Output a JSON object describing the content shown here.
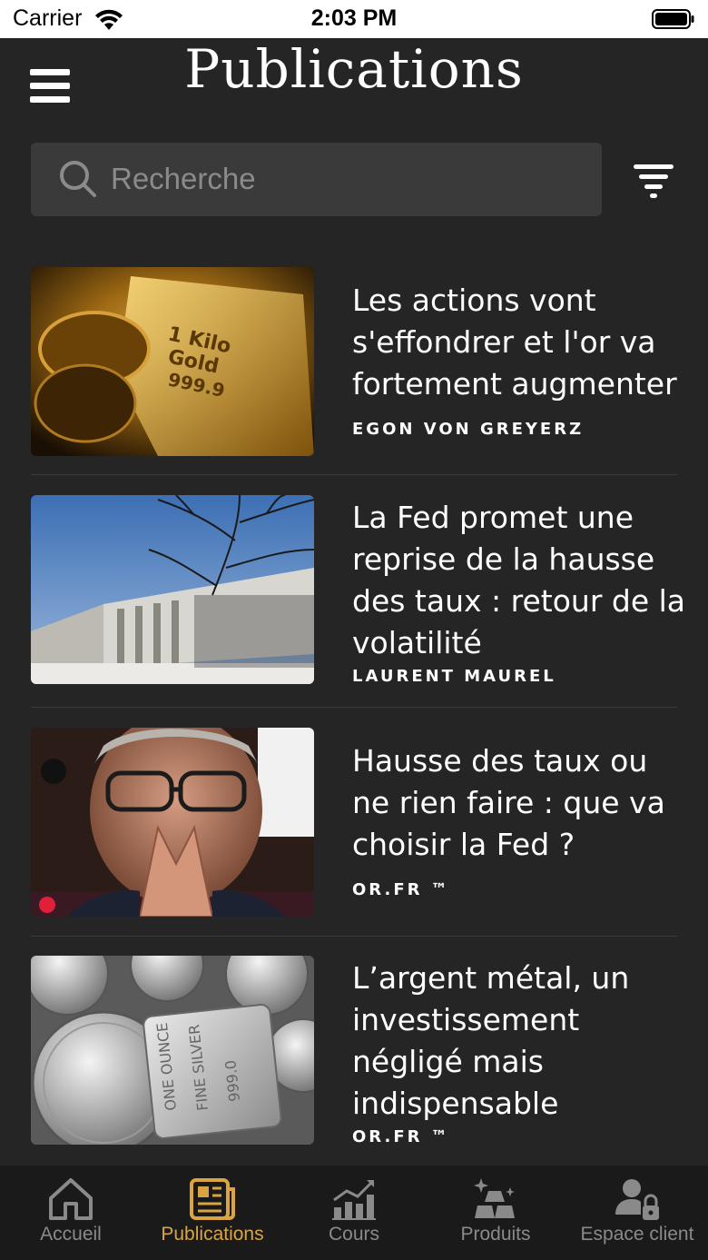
{
  "status_bar": {
    "carrier": "Carrier",
    "time": "2:03 PM"
  },
  "header": {
    "title": "Publications"
  },
  "search": {
    "placeholder": "Recherche"
  },
  "articles": [
    {
      "title": "Les actions vont s'effondrer et l'or va fortement augmenter",
      "author": "EGON VON GREYERZ",
      "image": "gold-bar-image"
    },
    {
      "title": "La Fed promet une reprise de la hausse des taux : retour de la volatilité",
      "author": "LAURENT MAUREL",
      "image": "federal-reserve-building-image"
    },
    {
      "title": "Hausse des taux ou ne rien faire : que va choisir la Fed ?",
      "author": "OR.FR ™",
      "image": "fed-chair-portrait-image"
    },
    {
      "title": "L’argent métal, un investissement négligé mais indispensable",
      "author": "OR.FR ™",
      "image": "silver-coins-image"
    }
  ],
  "tabs": [
    {
      "label": "Accueil",
      "icon": "home-icon",
      "active": false
    },
    {
      "label": "Publications",
      "icon": "newspaper-icon",
      "active": true
    },
    {
      "label": "Cours",
      "icon": "chart-icon",
      "active": false
    },
    {
      "label": "Produits",
      "icon": "gold-bars-icon",
      "active": false
    },
    {
      "label": "Espace client",
      "icon": "user-lock-icon",
      "active": false
    }
  ],
  "colors": {
    "background": "#252526",
    "accent": "#d9a441",
    "tab_inactive": "#8a8a8a",
    "search_bg": "#3a3a3b"
  }
}
